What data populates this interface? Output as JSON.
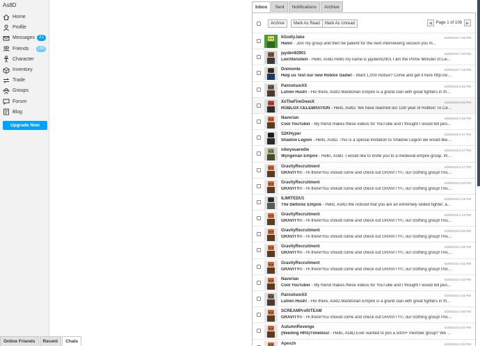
{
  "sidebar": {
    "username": "As8D",
    "items": [
      {
        "label": "Home",
        "icon": "home-icon",
        "badge": ""
      },
      {
        "label": "Profile",
        "icon": "profile-icon",
        "badge": ""
      },
      {
        "label": "Messages",
        "icon": "messages-icon",
        "badge": "21"
      },
      {
        "label": "Friends",
        "icon": "friends-icon",
        "badge": "190"
      },
      {
        "label": "Character",
        "icon": "character-icon",
        "badge": ""
      },
      {
        "label": "Inventory",
        "icon": "inventory-icon",
        "badge": ""
      },
      {
        "label": "Trade",
        "icon": "trade-icon",
        "badge": ""
      },
      {
        "label": "Groups",
        "icon": "groups-icon",
        "badge": ""
      },
      {
        "label": "Forum",
        "icon": "forum-icon",
        "badge": ""
      },
      {
        "label": "Blog",
        "icon": "blog-icon",
        "badge": ""
      }
    ],
    "upgrade_label": "Upgrade Now"
  },
  "chat_tabs": [
    "Online Friends",
    "Recent",
    "Chats"
  ],
  "inbox": {
    "tabs": [
      "Inbox",
      "Sent",
      "Notifications",
      "Archive"
    ],
    "toolbar": {
      "archive_label": "Archive",
      "mark_read_label": "Mark As Read",
      "mark_unread_label": "Mark As Unread"
    },
    "pager": {
      "prev": "◀",
      "text": "Page 1 of 106",
      "next": "▶"
    },
    "messages": [
      {
        "sender": "IiGodlyJake",
        "subject": "Hello!",
        "preview": "Join my group and then be patient for the next interviewing session you m...",
        "time": "6/29/2015 7:56 PM",
        "avatar": "green"
      },
      {
        "sender": "jayden92901",
        "subject": "Liechtenstein",
        "preview": "Hello, As8D.Hello my name is jayden92901 I am the Prime Minister of Liechtens...",
        "time": "6/29/2015 7:20 PM",
        "avatar": "brown"
      },
      {
        "sender": "Dremonte",
        "subject": "Help us Test our new Roblox Game!",
        "preview": "Want 1,000 Robux? Come and get it here http://www.ro...",
        "time": "6/29/2015 7:18 PM",
        "avatar": "dark"
      },
      {
        "sender": "PatriotismXX",
        "subject": "Lutren Hush!",
        "preview": "Hoi there, As8D.Mandorian Empire is a grand clan with great fighters in the med...",
        "time": "6/29/2015 6:52 PM",
        "avatar": "knight"
      },
      {
        "sender": "XxTheFireOnexX",
        "subject": "ROBLOX CELEBRATION",
        "preview": "Hello, As8D. We have reached our 11th year of Roblox! To Celebrate...",
        "time": "6/29/2015 5:30 PM",
        "avatar": "fire"
      },
      {
        "sender": "Naverian",
        "subject": "Cool YouTuber",
        "preview": "My friend makes these videos for YouTube and I thought I would tell people a...",
        "time": "6/29/2015 5:28 PM",
        "avatar": "orange"
      },
      {
        "sender": "S2KHyper",
        "subject": "Shadow Legion",
        "preview": "Hello, As8D. This is a special invitation to Shadow Legion we would like to inv...",
        "time": "6/29/2015 5:27 PM",
        "avatar": "black"
      },
      {
        "sender": "nikeyouaredie",
        "subject": "Wyngerian Empire",
        "preview": "Hello, As8D. I would like to invite you to a medieval empire group. We hav...",
        "time": "6/29/2015 5:27 PM",
        "avatar": "olive"
      },
      {
        "sender": "GravityRecruitment",
        "subject": "GRAVITY©",
        "preview": "Hi there!You should come and check out GRAVITY©, our clothing group!This group...",
        "time": "6/29/2015 5:27 PM",
        "avatar": "orange"
      },
      {
        "sender": "GravityRecruitment",
        "subject": "GRAVITY©",
        "preview": "Hi there!You should come and check out GRAVITY©, our clothing group!This group...",
        "time": "6/29/2015 5:20 PM",
        "avatar": "orange"
      },
      {
        "sender": "ILIMITEDU1",
        "subject": "The Deltonic Empire",
        "preview": "Hello, As8D.We noticed that you are an extremely skilled fighter, and we...",
        "time": "6/29/2015 5:18 PM",
        "avatar": "hat"
      },
      {
        "sender": "GravityRecruitment",
        "subject": "GRAVITY©",
        "preview": "Hi there!You should come and check out GRAVITY©, our clothing group!This group...",
        "time": "6/29/2015 5:13 PM",
        "avatar": "orange"
      },
      {
        "sender": "GravityRecruitment",
        "subject": "GRAVITY©",
        "preview": "Hi there!You should come and check out GRAVITY©, our clothing group!This group...",
        "time": "6/29/2015 5:06 PM",
        "avatar": "orange"
      },
      {
        "sender": "GravityRecruitment",
        "subject": "GRAVITY©",
        "preview": "Hi there!You should come and check out GRAVITY©, our clothing group!This group...",
        "time": "6/29/2015 4:59 PM",
        "avatar": "orange"
      },
      {
        "sender": "GravityRecruitment",
        "subject": "GRAVITY©",
        "preview": "Hi there!You should come and check out GRAVITY©, our clothing group!This group...",
        "time": "6/29/2015 4:52 PM",
        "avatar": "orange"
      },
      {
        "sender": "Naverian",
        "subject": "Cool YouTuber",
        "preview": "My friend makes these videos for YouTube and I thought I would tell people a...",
        "time": "6/29/2015 4:23 PM",
        "avatar": "orange"
      },
      {
        "sender": "PatriotismXX",
        "subject": "Lutren Hush!",
        "preview": "Hoi there, As8D.Mandorian Empire is a grand clan with great fighters in the med...",
        "time": "6/29/2015 4:15 PM",
        "avatar": "knight"
      },
      {
        "sender": "SCREAMProfitTEAM",
        "subject": "GRAVITY©",
        "preview": "Hi there!You should come and check out GRAVITY©, our clothing group!This group...",
        "time": "6/29/2015 4:00 PM",
        "avatar": "orange"
      },
      {
        "sender": "AutumnRevenge",
        "subject": "(Needing HRS)Timeless!",
        "preview": "Hello, As8D.Ever wanted to join a 5000+ member group? We are hir...",
        "time": "6/29/2015 3:57 PM",
        "avatar": "orange"
      },
      {
        "sender": "Apexzh",
        "subject": "",
        "preview": "",
        "time": "6/29/2015 3:40 PM",
        "avatar": "orange"
      }
    ]
  },
  "colors": {
    "accent": "#00a2ff",
    "sidebar_bg": "#f2f2f2",
    "edge_strip": "#3b4a5c"
  }
}
